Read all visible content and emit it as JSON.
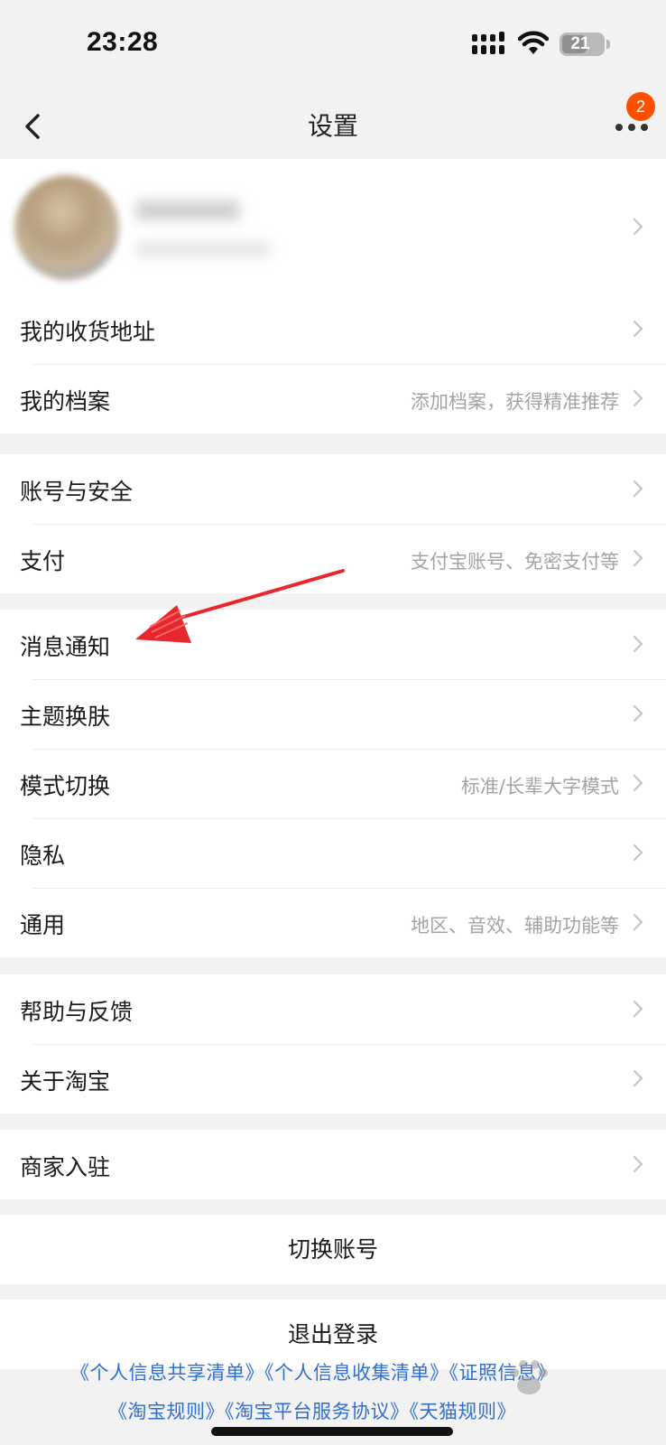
{
  "status_bar": {
    "time": "23:28",
    "battery": "21"
  },
  "nav": {
    "title": "设置",
    "badge": "2"
  },
  "groups": {
    "profile": {
      "rows": [
        {
          "label": "我的收货地址",
          "value": ""
        },
        {
          "label": "我的档案",
          "value": "添加档案，获得精准推荐"
        }
      ]
    },
    "account": {
      "rows": [
        {
          "label": "账号与安全",
          "value": ""
        },
        {
          "label": "支付",
          "value": "支付宝账号、免密支付等"
        }
      ]
    },
    "preferences": {
      "rows": [
        {
          "label": "消息通知",
          "value": ""
        },
        {
          "label": "主题换肤",
          "value": ""
        },
        {
          "label": "模式切换",
          "value": "标准/长辈大字模式"
        },
        {
          "label": "隐私",
          "value": ""
        },
        {
          "label": "通用",
          "value": "地区、音效、辅助功能等"
        }
      ]
    },
    "help": {
      "rows": [
        {
          "label": "帮助与反馈",
          "value": ""
        },
        {
          "label": "关于淘宝",
          "value": ""
        }
      ]
    },
    "merchant": {
      "rows": [
        {
          "label": "商家入驻",
          "value": ""
        }
      ]
    }
  },
  "actions": {
    "switch_account": "切换账号",
    "logout": "退出登录"
  },
  "footer": {
    "links_line1": [
      "《个人信息共享清单》",
      "《个人信息收集清单》",
      "《证照信息》"
    ],
    "links_line2": [
      "《淘宝规则》",
      "《淘宝平台服务协议》",
      "《天猫规则》"
    ]
  },
  "colors": {
    "accent": "#ff5000",
    "link": "#2f6fd0",
    "annotation_arrow": "#e8262e"
  },
  "icons": [
    "signal-icon",
    "wifi-icon",
    "battery-icon",
    "back-arrow-icon",
    "more-dots-icon",
    "chevron-right-icon"
  ]
}
